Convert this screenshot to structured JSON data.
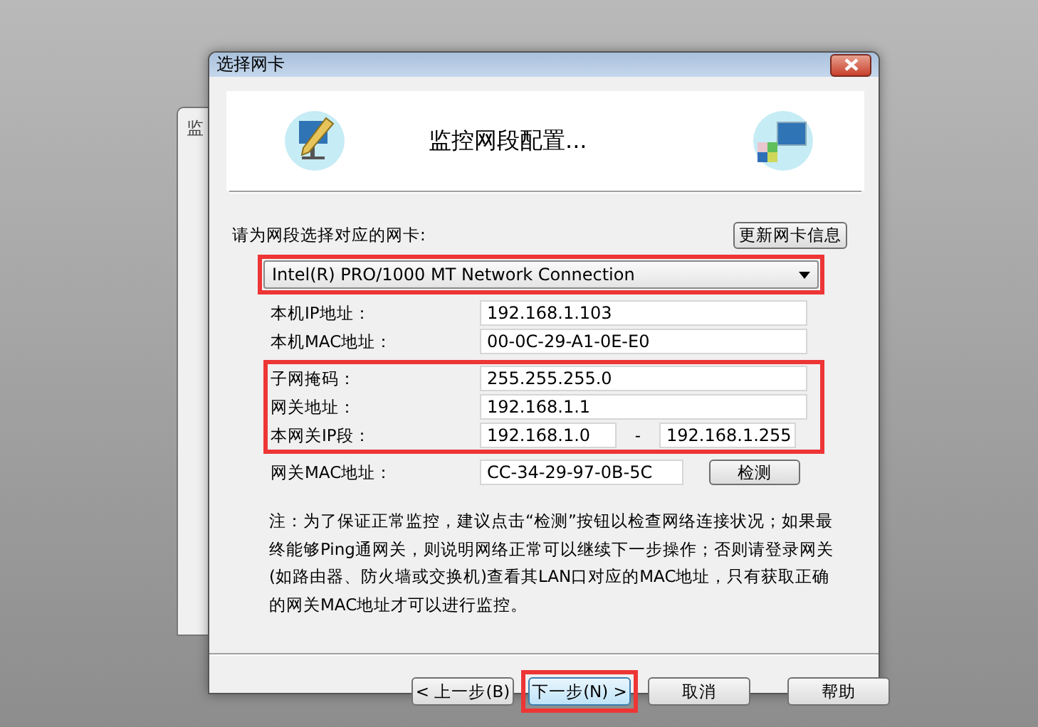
{
  "background_window": {
    "title": "监"
  },
  "window": {
    "title": "选择网卡"
  },
  "header": {
    "title": "监控网段配置..."
  },
  "adapter": {
    "label": "请为网段选择对应的网卡:",
    "refresh_button": "更新网卡信息",
    "value": "Intel(R) PRO/1000 MT Network Connection",
    "highlighted": true
  },
  "field_groups": [
    {
      "highlighted": false,
      "fields": [
        {
          "kind": "single",
          "label": "本机IP地址：",
          "value": "192.168.1.103"
        },
        {
          "kind": "single",
          "label": "本机MAC地址：",
          "value": "00-0C-29-A1-0E-E0"
        }
      ]
    },
    {
      "highlighted": true,
      "fields": [
        {
          "kind": "single",
          "label": "子网掩码：",
          "value": "255.255.255.0"
        },
        {
          "kind": "single",
          "label": "网关地址：",
          "value": "192.168.1.1"
        },
        {
          "kind": "range",
          "label": "本网关IP段：",
          "value": "192.168.1.0",
          "separator": "-",
          "value_end": "192.168.1.255"
        }
      ]
    },
    {
      "highlighted": false,
      "fields": [
        {
          "kind": "button",
          "label": "网关MAC地址：",
          "value": "CC-34-29-97-0B-5C",
          "button": "检测"
        }
      ]
    }
  ],
  "note": "注：为了保证正常监控，建议点击“检测”按钮以检查网络连接状况；如果最终能够Ping通网关，则说明网络正常可以继续下一步操作；否则请登录网关(如路由器、防火墙或交换机)查看其LAN口对应的MAC地址，只有获取正确的网关MAC地址才可以进行监控。",
  "buttons": [
    {
      "label": "< 上一步(B)",
      "default": false,
      "highlighted": false
    },
    {
      "label": "下一步(N) >",
      "default": true,
      "highlighted": true
    },
    {
      "label": "取消",
      "default": false,
      "highlighted": false
    },
    {
      "label": "帮助",
      "default": false,
      "highlighted": false
    }
  ]
}
